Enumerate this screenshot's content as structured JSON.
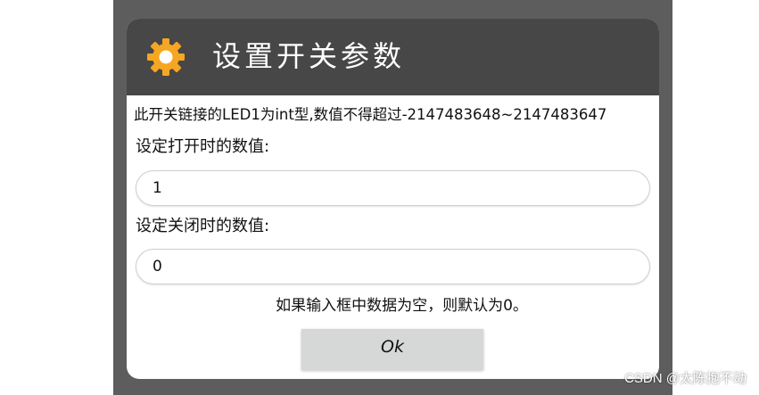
{
  "dialog": {
    "title": "设置开关参数",
    "icon": "gear-icon",
    "info": "此开关链接的LED1为int型,数值不得超过-2147483648~2147483647",
    "open_label": "设定打开时的数值:",
    "open_value": "1",
    "close_label": "设定关闭时的数值:",
    "close_value": "0",
    "hint": "如果输入框中数据为空，则默认为0。",
    "ok_label": "Ok"
  },
  "watermark": "CSDN @太陈抱不动",
  "colors": {
    "background": "#5d5d5d",
    "header": "#474747",
    "gear": "#f5a623",
    "button": "#d6d7d7"
  }
}
